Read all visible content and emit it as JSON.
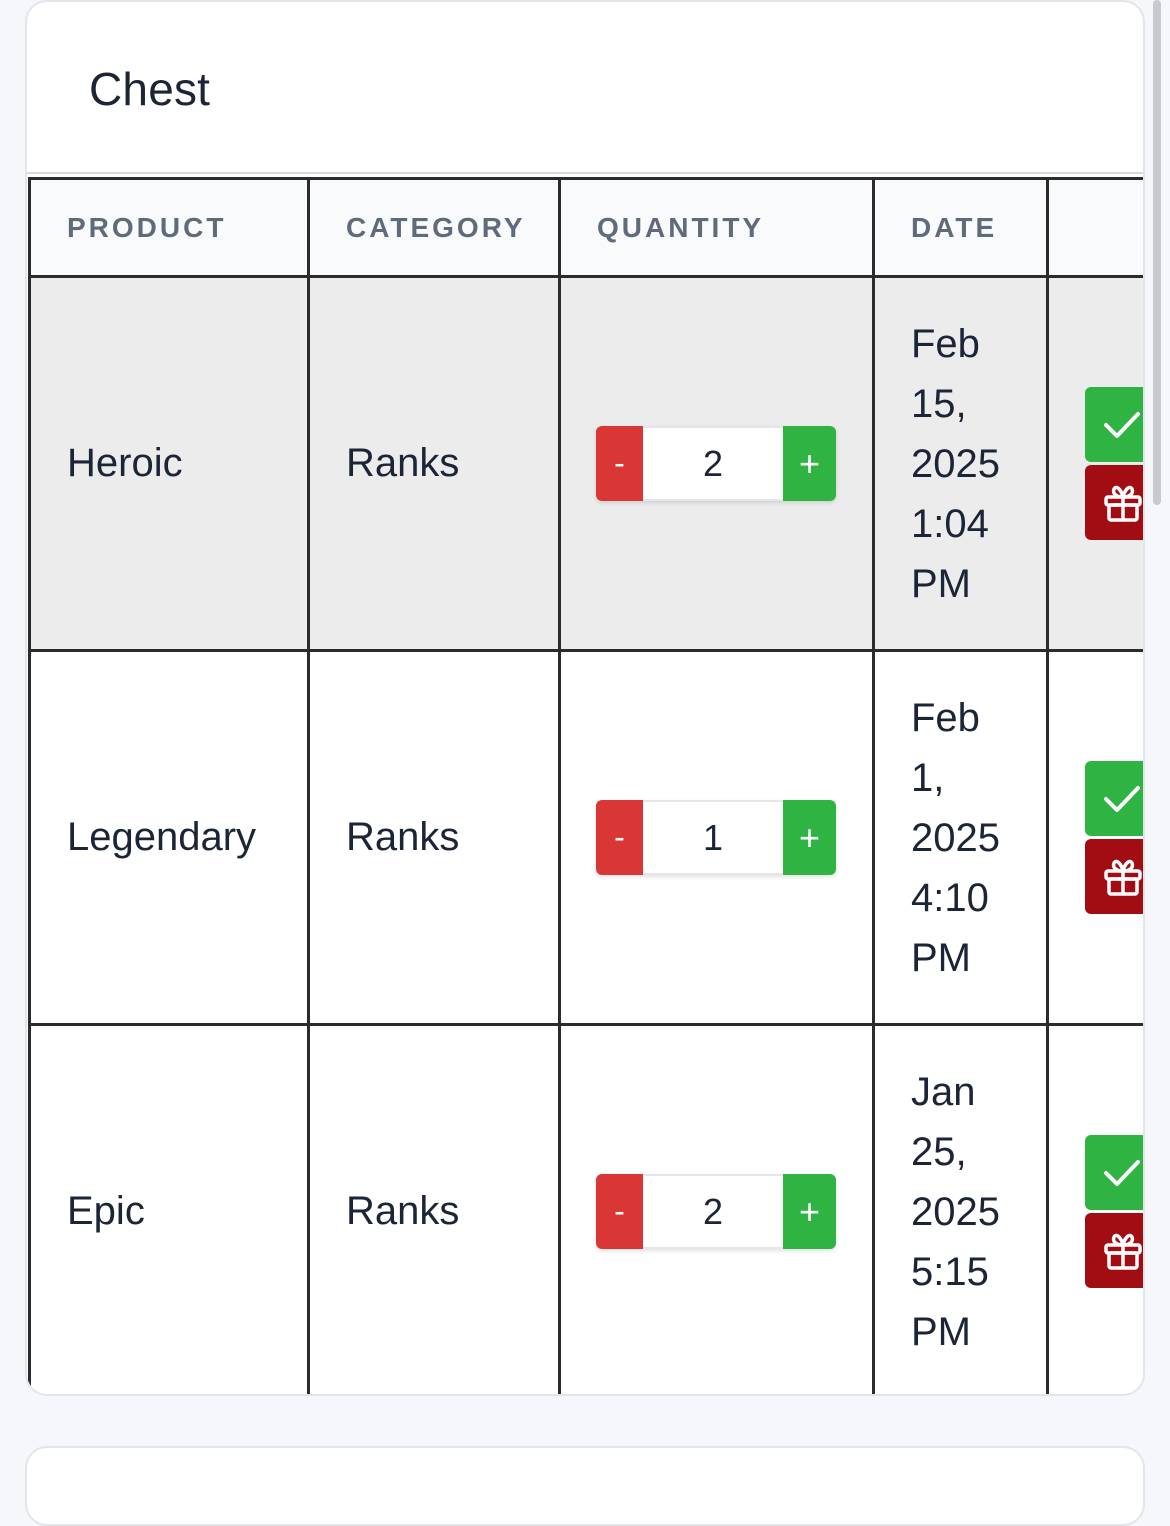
{
  "card": {
    "title": "Chest"
  },
  "table": {
    "headers": [
      "PRODUCT",
      "CATEGORY",
      "QUANTITY",
      "DATE",
      ""
    ],
    "rows": [
      {
        "product": "Heroic",
        "category": "Ranks",
        "quantity": "2",
        "date_lines": [
          "Feb",
          "15,",
          "2025",
          "1:04",
          "PM"
        ]
      },
      {
        "product": "Legendary",
        "category": "Ranks",
        "quantity": "1",
        "date_lines": [
          "Feb",
          "1,",
          "2025",
          "4:10",
          "PM"
        ]
      },
      {
        "product": "Epic",
        "category": "Ranks",
        "quantity": "2",
        "date_lines": [
          "Jan",
          "25,",
          "2025",
          "5:15",
          "PM"
        ]
      }
    ],
    "stepper": {
      "minus_label": "-",
      "plus_label": "+"
    },
    "actions": {
      "accept_icon": "check-icon",
      "gift_icon": "gift-icon"
    }
  },
  "colors": {
    "accent_green": "#2fb342",
    "danger_red": "#d93636",
    "gift_red": "#a10d12",
    "highlight_row": "#ececec"
  }
}
